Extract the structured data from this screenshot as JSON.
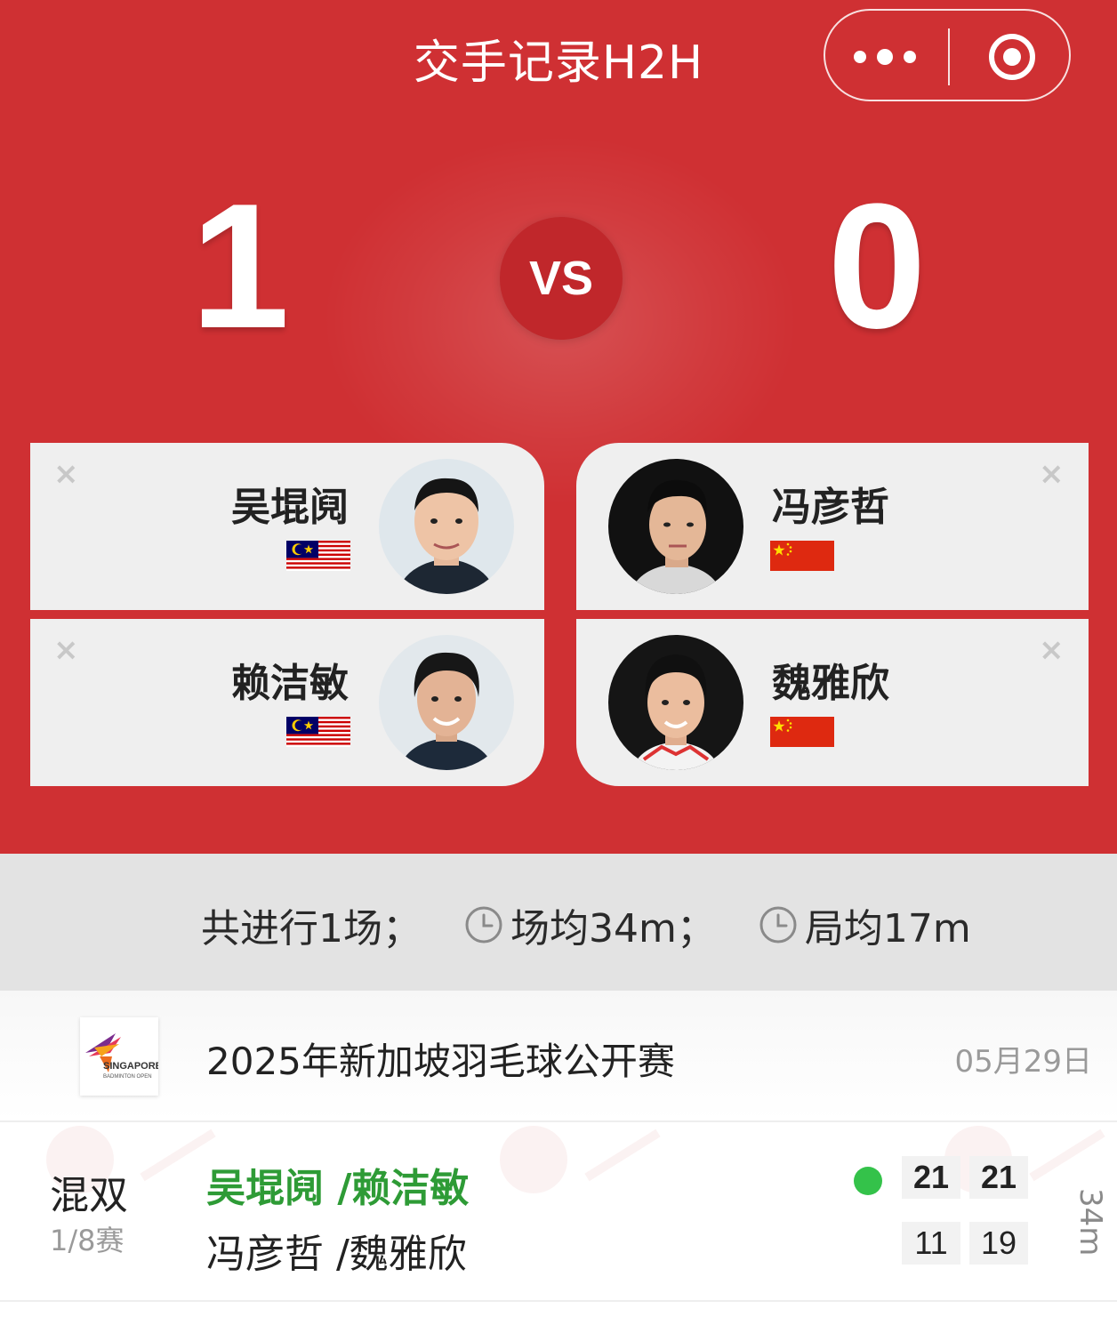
{
  "header": {
    "title": "交手记录H2H",
    "menu_icon": "more-dots-icon",
    "close_icon": "target-circle-icon"
  },
  "scoreboard": {
    "left_wins": "1",
    "vs_label": "VS",
    "right_wins": "0"
  },
  "players": {
    "left": [
      {
        "name": "吴堒阋",
        "country": "Malaysia",
        "flag": "malaysia-flag-icon"
      },
      {
        "name": "赖洁敏",
        "country": "Malaysia",
        "flag": "malaysia-flag-icon"
      }
    ],
    "right": [
      {
        "name": "冯彦哲",
        "country": "China",
        "flag": "china-flag-icon"
      },
      {
        "name": "魏雅欣",
        "country": "China",
        "flag": "china-flag-icon"
      }
    ],
    "remove_glyph": "×"
  },
  "stats": {
    "matches": "共进行1场；",
    "avg_match": "场均34m；",
    "avg_game": "局均17m"
  },
  "event": {
    "name": "2025年新加坡羽毛球公开赛",
    "date": "05月29日",
    "logo_text_1": "SINGAPORE",
    "logo_text_2": "BADMINTON OPEN"
  },
  "match": {
    "type": "混双",
    "round": "1/8赛",
    "winner_team": "吴堒阋 /赖洁敏",
    "loser_team": "冯彦哲 /魏雅欣",
    "winner_scores": [
      "21",
      "21"
    ],
    "loser_scores": [
      "11",
      "19"
    ],
    "duration": "34m"
  },
  "colors": {
    "brand_red": "#cf3033",
    "winner_green": "#2e9b36",
    "dot_green": "#34c24a"
  }
}
